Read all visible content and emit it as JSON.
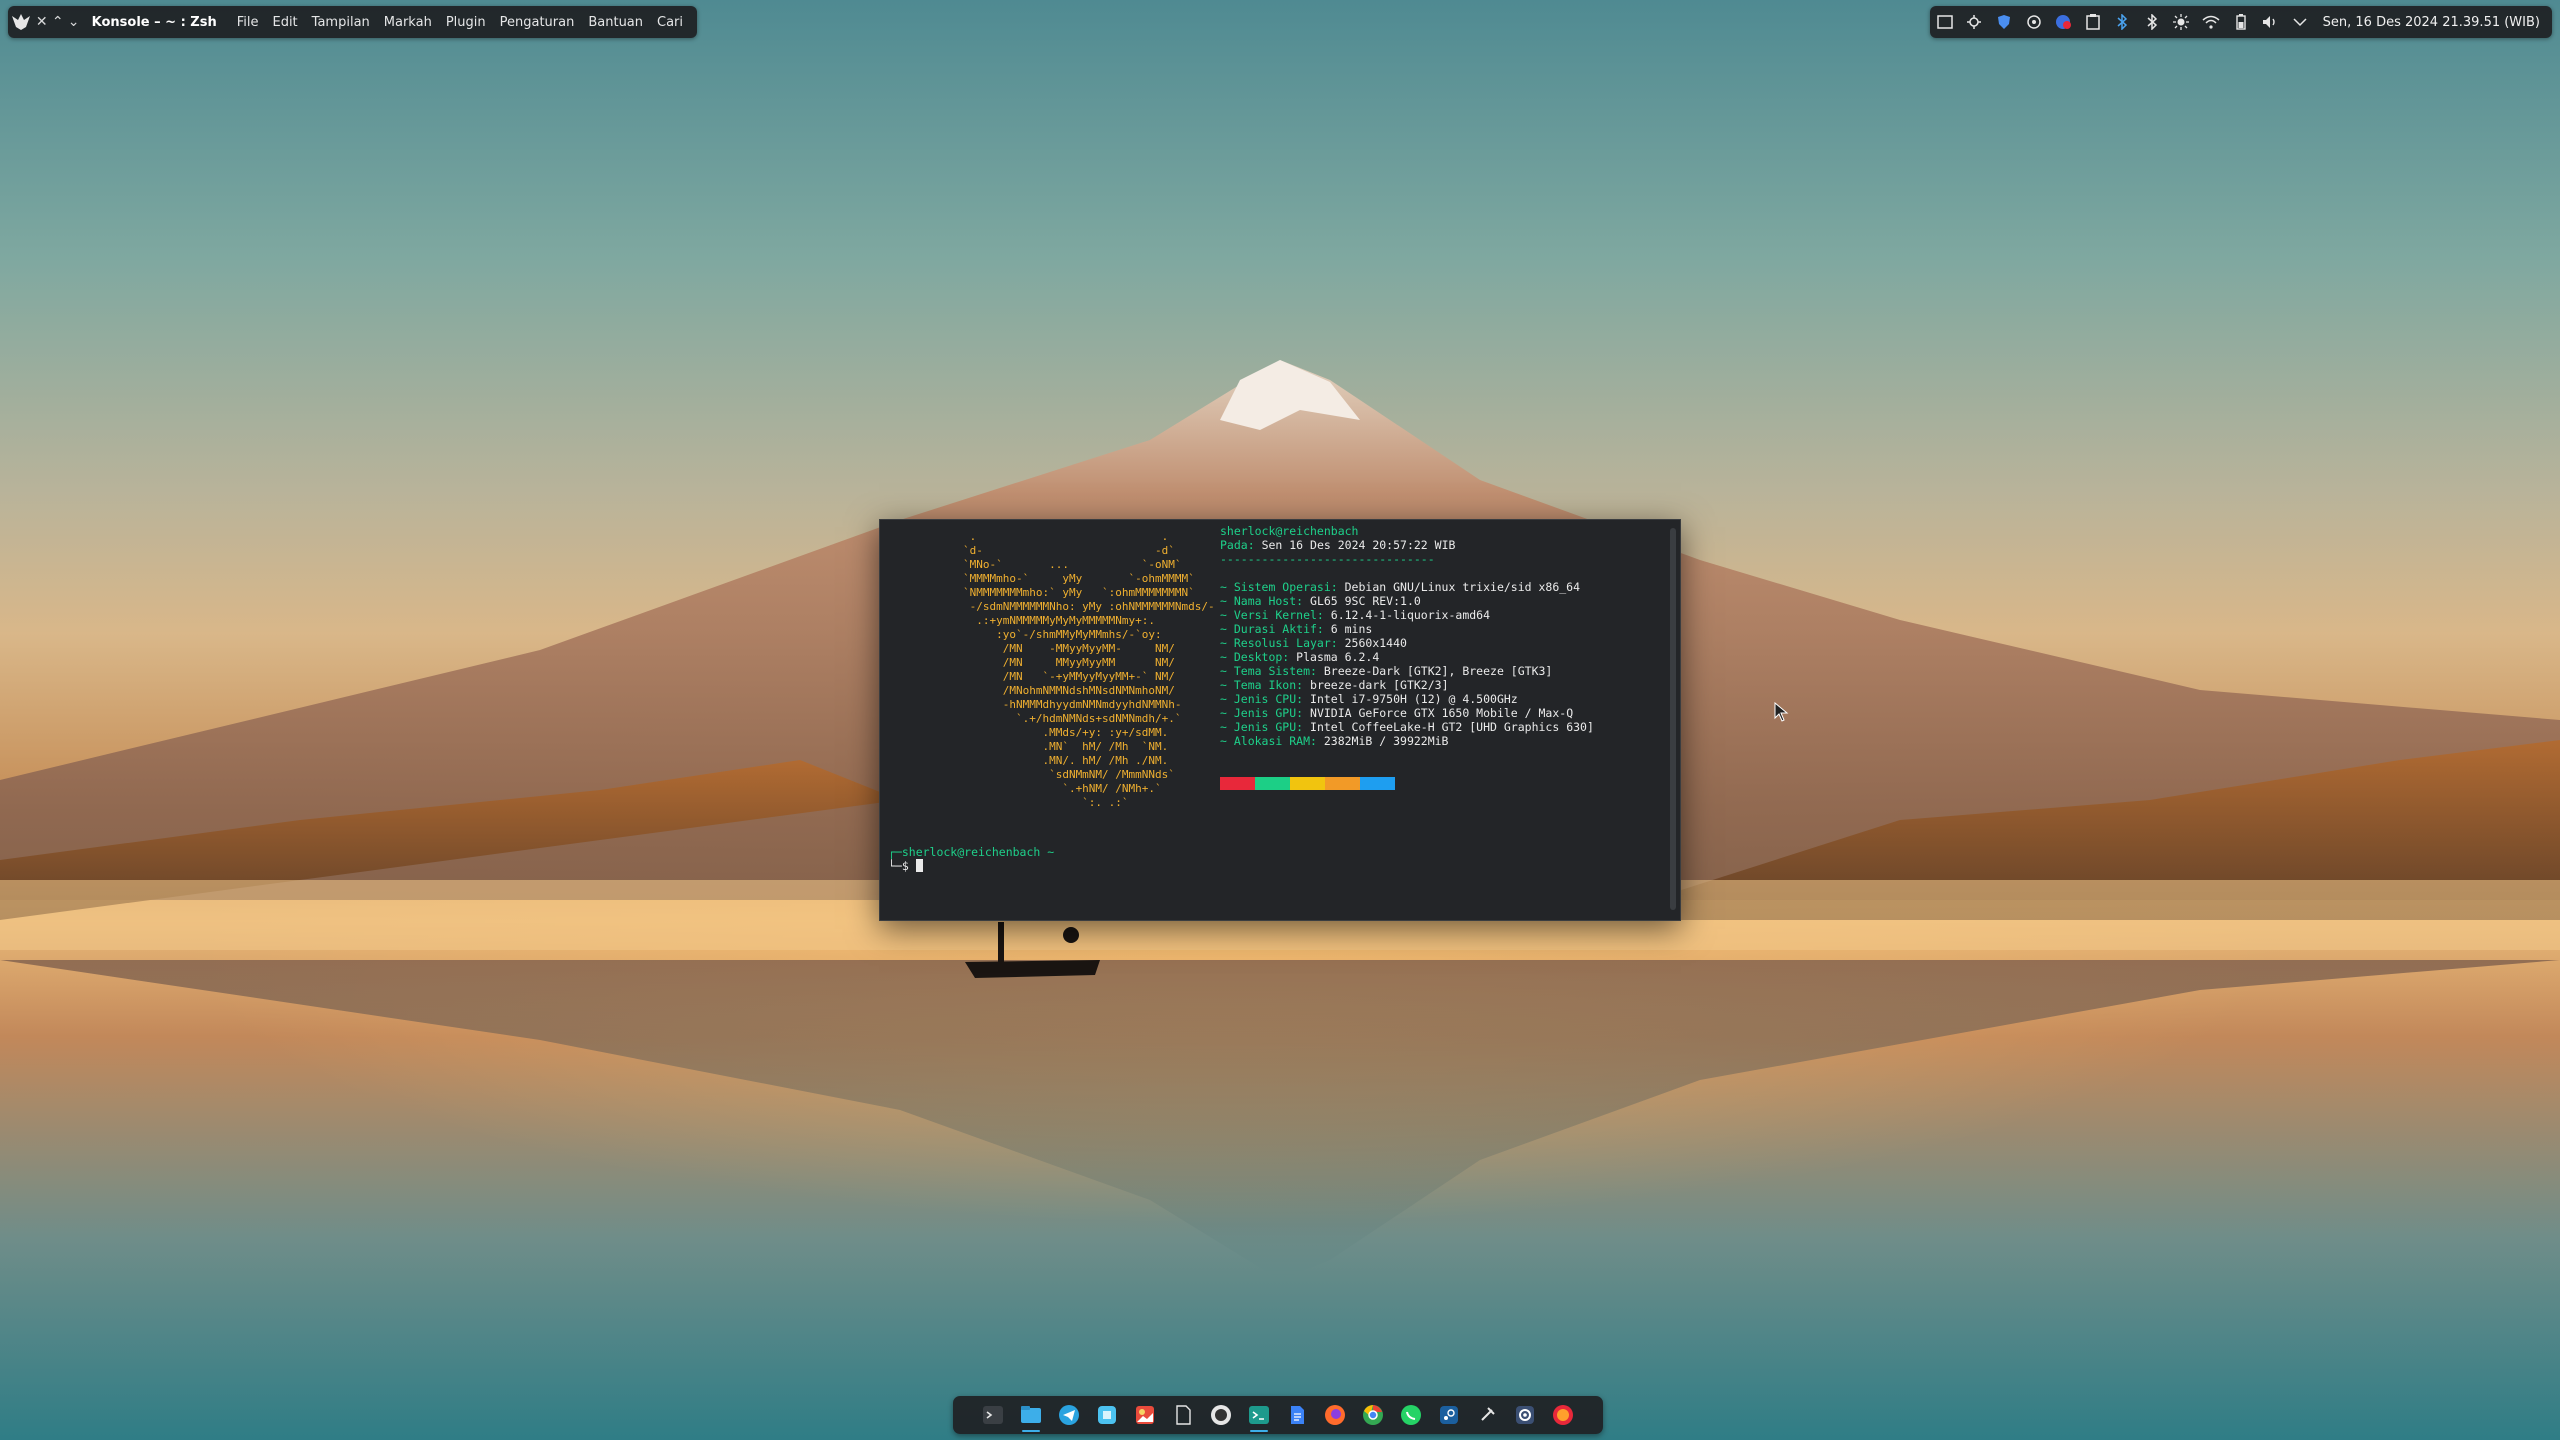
{
  "top_panel": {
    "app_title": "Konsole – ~ : Zsh",
    "menu": [
      "File",
      "Edit",
      "Tampilan",
      "Markah",
      "Plugin",
      "Pengaturan",
      "Bantuan",
      "Cari"
    ],
    "clock": "Sen, 16 Des 2024  21.39.51 (WIB)"
  },
  "terminal": {
    "ascii_art": "         .                            .\n        `d-                          -d`\n        `MNo-`       ...           `-oNM`\n        `MMMMmho-`     yMy       `-ohmMMMM`\n        `NMMMMMMMmho:` yMy   `:ohmMMMMMMMN`\n         -/sdmNMMMMMMNho: yMy :ohNMMMMMMNmds/-\n          .:+ymNMMMMMyMyMyMMMMMNmy+:.\n             :yo`-/shmMMyMyMMmhs/-`oy:\n              /MN    -MMyyMyyMM-     NM/\n              /MN     MMyyMyyMM      NM/\n              /MN   `-+yMMyyMyyMM+-` NM/\n              /MNohmNMMNdshMNsdNMNmhoNM/\n              -hNMMMdhyydmNMNmdyyhdNMMNh-\n                `.+/hdmNMNds+sdNMNmdh/+.`\n                    .MMds/+y: :y+/sdMM.\n                    .MN`  hM/ /Mh  `NM.\n                    .MN/. hM/ /Mh ./NM.\n                     `sdNMmNM/ /MmmNNds`\n                       `.+hNM/ /NMh+.`\n                          `:. .:`",
    "user_host": "sherlock@reichenbach",
    "date_label": "Pada",
    "date_value": "Sen 16 Des 2024 20:57:22 WIB",
    "separator": "-------------------------------",
    "info": [
      {
        "key": "~ Sistem Operasi:",
        "value": " Debian GNU/Linux trixie/sid x86_64"
      },
      {
        "key": "~ Nama Host:",
        "value": " GL65 9SC REV:1.0"
      },
      {
        "key": "~ Versi Kernel:",
        "value": " 6.12.4-1-liquorix-amd64"
      },
      {
        "key": "~ Durasi Aktif:",
        "value": " 6 mins"
      },
      {
        "key": "~ Resolusi Layar:",
        "value": " 2560x1440"
      },
      {
        "key": "~ Desktop:",
        "value": " Plasma 6.2.4"
      },
      {
        "key": "~ Tema Sistem:",
        "value": " Breeze-Dark [GTK2], Breeze [GTK3]"
      },
      {
        "key": "~ Tema Ikon:",
        "value": " breeze-dark [GTK2/3]"
      },
      {
        "key": "~ Jenis CPU:",
        "value": " Intel i7-9750H (12) @ 4.500GHz"
      },
      {
        "key": "~ Jenis GPU:",
        "value": " NVIDIA GeForce GTX 1650 Mobile / Max-Q"
      },
      {
        "key": "~ Jenis GPU:",
        "value": " Intel CoffeeLake-H GT2 [UHD Graphics 630]"
      },
      {
        "key": "~ Alokasi RAM:",
        "value": " 2382MiB / 39922MiB"
      }
    ],
    "palette": [
      "#e8283a",
      "#1ccf86",
      "#f1c40f",
      "#f29a27",
      "#1e9ef0"
    ],
    "prompt_line": "┌─sherlock@reichenbach ~",
    "prompt_symbol": "└─$ "
  },
  "tray_icons": [
    "screen-icon",
    "network-settings-icon",
    "shield-icon",
    "vpn-icon",
    "notification-badge-icon",
    "clipboard-icon",
    "bluetooth-icon",
    "bluetooth-alt-icon",
    "brightness-icon",
    "wifi-icon",
    "battery-icon",
    "volume-icon",
    "chevron-down-icon"
  ],
  "dock_apps": [
    "terminal-icon",
    "files-icon",
    "telegram-icon",
    "store-icon",
    "gallery-icon",
    "document-icon",
    "obs-icon",
    "konsole-icon",
    "notes-icon",
    "firefox-icon",
    "chrome-icon",
    "whatsapp-icon",
    "steam-icon",
    "pin-icon",
    "settings-icon",
    "firefox-dev-icon"
  ],
  "colors": {
    "accent": "#3daee9",
    "term_green": "#1ed08a",
    "ascii_orange": "#f0b030"
  }
}
